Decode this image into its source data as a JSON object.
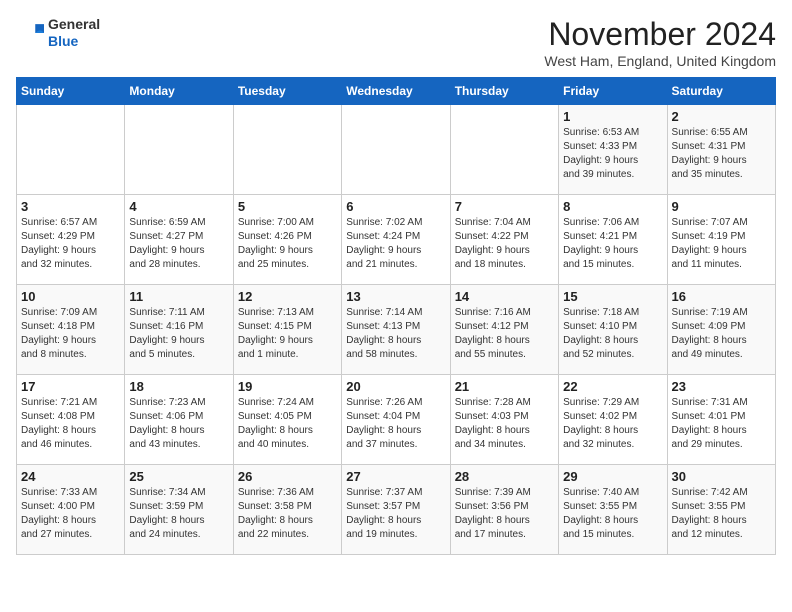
{
  "logo": {
    "general": "General",
    "blue": "Blue"
  },
  "title": "November 2024",
  "location": "West Ham, England, United Kingdom",
  "days_of_week": [
    "Sunday",
    "Monday",
    "Tuesday",
    "Wednesday",
    "Thursday",
    "Friday",
    "Saturday"
  ],
  "weeks": [
    [
      {
        "day": "",
        "info": ""
      },
      {
        "day": "",
        "info": ""
      },
      {
        "day": "",
        "info": ""
      },
      {
        "day": "",
        "info": ""
      },
      {
        "day": "",
        "info": ""
      },
      {
        "day": "1",
        "info": "Sunrise: 6:53 AM\nSunset: 4:33 PM\nDaylight: 9 hours\nand 39 minutes."
      },
      {
        "day": "2",
        "info": "Sunrise: 6:55 AM\nSunset: 4:31 PM\nDaylight: 9 hours\nand 35 minutes."
      }
    ],
    [
      {
        "day": "3",
        "info": "Sunrise: 6:57 AM\nSunset: 4:29 PM\nDaylight: 9 hours\nand 32 minutes."
      },
      {
        "day": "4",
        "info": "Sunrise: 6:59 AM\nSunset: 4:27 PM\nDaylight: 9 hours\nand 28 minutes."
      },
      {
        "day": "5",
        "info": "Sunrise: 7:00 AM\nSunset: 4:26 PM\nDaylight: 9 hours\nand 25 minutes."
      },
      {
        "day": "6",
        "info": "Sunrise: 7:02 AM\nSunset: 4:24 PM\nDaylight: 9 hours\nand 21 minutes."
      },
      {
        "day": "7",
        "info": "Sunrise: 7:04 AM\nSunset: 4:22 PM\nDaylight: 9 hours\nand 18 minutes."
      },
      {
        "day": "8",
        "info": "Sunrise: 7:06 AM\nSunset: 4:21 PM\nDaylight: 9 hours\nand 15 minutes."
      },
      {
        "day": "9",
        "info": "Sunrise: 7:07 AM\nSunset: 4:19 PM\nDaylight: 9 hours\nand 11 minutes."
      }
    ],
    [
      {
        "day": "10",
        "info": "Sunrise: 7:09 AM\nSunset: 4:18 PM\nDaylight: 9 hours\nand 8 minutes."
      },
      {
        "day": "11",
        "info": "Sunrise: 7:11 AM\nSunset: 4:16 PM\nDaylight: 9 hours\nand 5 minutes."
      },
      {
        "day": "12",
        "info": "Sunrise: 7:13 AM\nSunset: 4:15 PM\nDaylight: 9 hours\nand 1 minute."
      },
      {
        "day": "13",
        "info": "Sunrise: 7:14 AM\nSunset: 4:13 PM\nDaylight: 8 hours\nand 58 minutes."
      },
      {
        "day": "14",
        "info": "Sunrise: 7:16 AM\nSunset: 4:12 PM\nDaylight: 8 hours\nand 55 minutes."
      },
      {
        "day": "15",
        "info": "Sunrise: 7:18 AM\nSunset: 4:10 PM\nDaylight: 8 hours\nand 52 minutes."
      },
      {
        "day": "16",
        "info": "Sunrise: 7:19 AM\nSunset: 4:09 PM\nDaylight: 8 hours\nand 49 minutes."
      }
    ],
    [
      {
        "day": "17",
        "info": "Sunrise: 7:21 AM\nSunset: 4:08 PM\nDaylight: 8 hours\nand 46 minutes."
      },
      {
        "day": "18",
        "info": "Sunrise: 7:23 AM\nSunset: 4:06 PM\nDaylight: 8 hours\nand 43 minutes."
      },
      {
        "day": "19",
        "info": "Sunrise: 7:24 AM\nSunset: 4:05 PM\nDaylight: 8 hours\nand 40 minutes."
      },
      {
        "day": "20",
        "info": "Sunrise: 7:26 AM\nSunset: 4:04 PM\nDaylight: 8 hours\nand 37 minutes."
      },
      {
        "day": "21",
        "info": "Sunrise: 7:28 AM\nSunset: 4:03 PM\nDaylight: 8 hours\nand 34 minutes."
      },
      {
        "day": "22",
        "info": "Sunrise: 7:29 AM\nSunset: 4:02 PM\nDaylight: 8 hours\nand 32 minutes."
      },
      {
        "day": "23",
        "info": "Sunrise: 7:31 AM\nSunset: 4:01 PM\nDaylight: 8 hours\nand 29 minutes."
      }
    ],
    [
      {
        "day": "24",
        "info": "Sunrise: 7:33 AM\nSunset: 4:00 PM\nDaylight: 8 hours\nand 27 minutes."
      },
      {
        "day": "25",
        "info": "Sunrise: 7:34 AM\nSunset: 3:59 PM\nDaylight: 8 hours\nand 24 minutes."
      },
      {
        "day": "26",
        "info": "Sunrise: 7:36 AM\nSunset: 3:58 PM\nDaylight: 8 hours\nand 22 minutes."
      },
      {
        "day": "27",
        "info": "Sunrise: 7:37 AM\nSunset: 3:57 PM\nDaylight: 8 hours\nand 19 minutes."
      },
      {
        "day": "28",
        "info": "Sunrise: 7:39 AM\nSunset: 3:56 PM\nDaylight: 8 hours\nand 17 minutes."
      },
      {
        "day": "29",
        "info": "Sunrise: 7:40 AM\nSunset: 3:55 PM\nDaylight: 8 hours\nand 15 minutes."
      },
      {
        "day": "30",
        "info": "Sunrise: 7:42 AM\nSunset: 3:55 PM\nDaylight: 8 hours\nand 12 minutes."
      }
    ]
  ]
}
